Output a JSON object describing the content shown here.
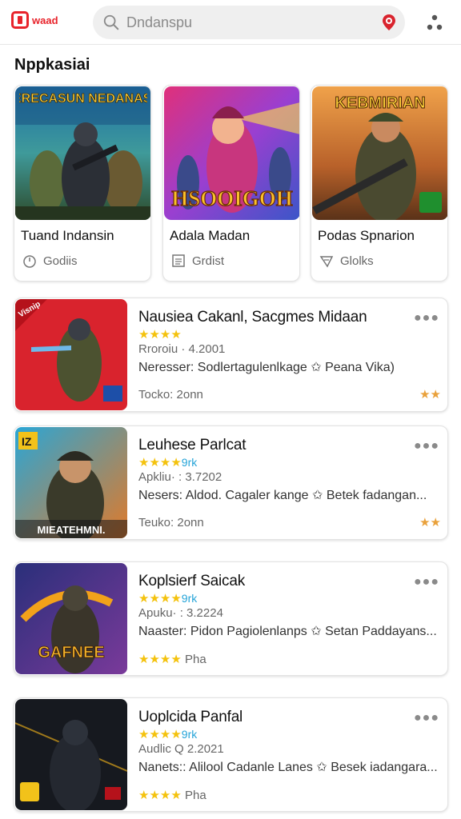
{
  "header": {
    "logo_text": "waad",
    "search_placeholder": "Dndanspu"
  },
  "section": {
    "title": "Nppkasiai"
  },
  "featured": [
    {
      "banner": "MERECASUN NEDANASIA",
      "title": "Tuand  Indansin",
      "meta": "Godiis"
    },
    {
      "banner": "HSOOIGOH",
      "title": "Adala Madan",
      "meta": "Grdist"
    },
    {
      "banner": "KEBMIRIAN",
      "title": "Podas Spnarion",
      "meta": "Glolks"
    }
  ],
  "list": [
    {
      "title": "Nausiea Cakanl, Sacgmes Midaan",
      "stars": "★★★★",
      "rk": "",
      "release": "Rroroiu · 4.2001",
      "news": "Neresser: Sodlertagulenlkage ✩ Peana Vika)",
      "footer": "Tocko: 2onn",
      "corner": "Visnip",
      "badge": "★★"
    },
    {
      "title": "Leuhese Parlcat",
      "stars": "★★★★",
      "rk": "9rk",
      "release": "Apkliu· : 3.7202",
      "news": "Nesers: Aldod. Cagaler kange ✩ Betek fadangan...",
      "footer": "Teuko: 2onn",
      "thumb_label": "MIEATEHMNI.",
      "corner": "IZ",
      "badge": "★★"
    },
    {
      "title": "Koplsierf Saicak",
      "stars": "★★★★",
      "rk": "9rk",
      "release": "Apuku· : 3.2224",
      "news": "Naaster: Pidon Pagiolenlanps ✩ Setan Paddayans...",
      "rating_stars": "★★★★",
      "rating_text": "Pha",
      "thumb_label": "GAFNEE"
    },
    {
      "title": "Uoplcida Panfal",
      "stars": "★★★★",
      "rk": "9rk",
      "release": "Audlic Q 2.2021",
      "news": "Nanets:: Alilool Cadanle Lanes ✩ Besek iadangara...",
      "rating_stars": "★★★★",
      "rating_text": "Pha"
    }
  ],
  "colors": {
    "brand": "#e8232b",
    "star": "#f4c20d",
    "accent": "#25a4d8"
  }
}
